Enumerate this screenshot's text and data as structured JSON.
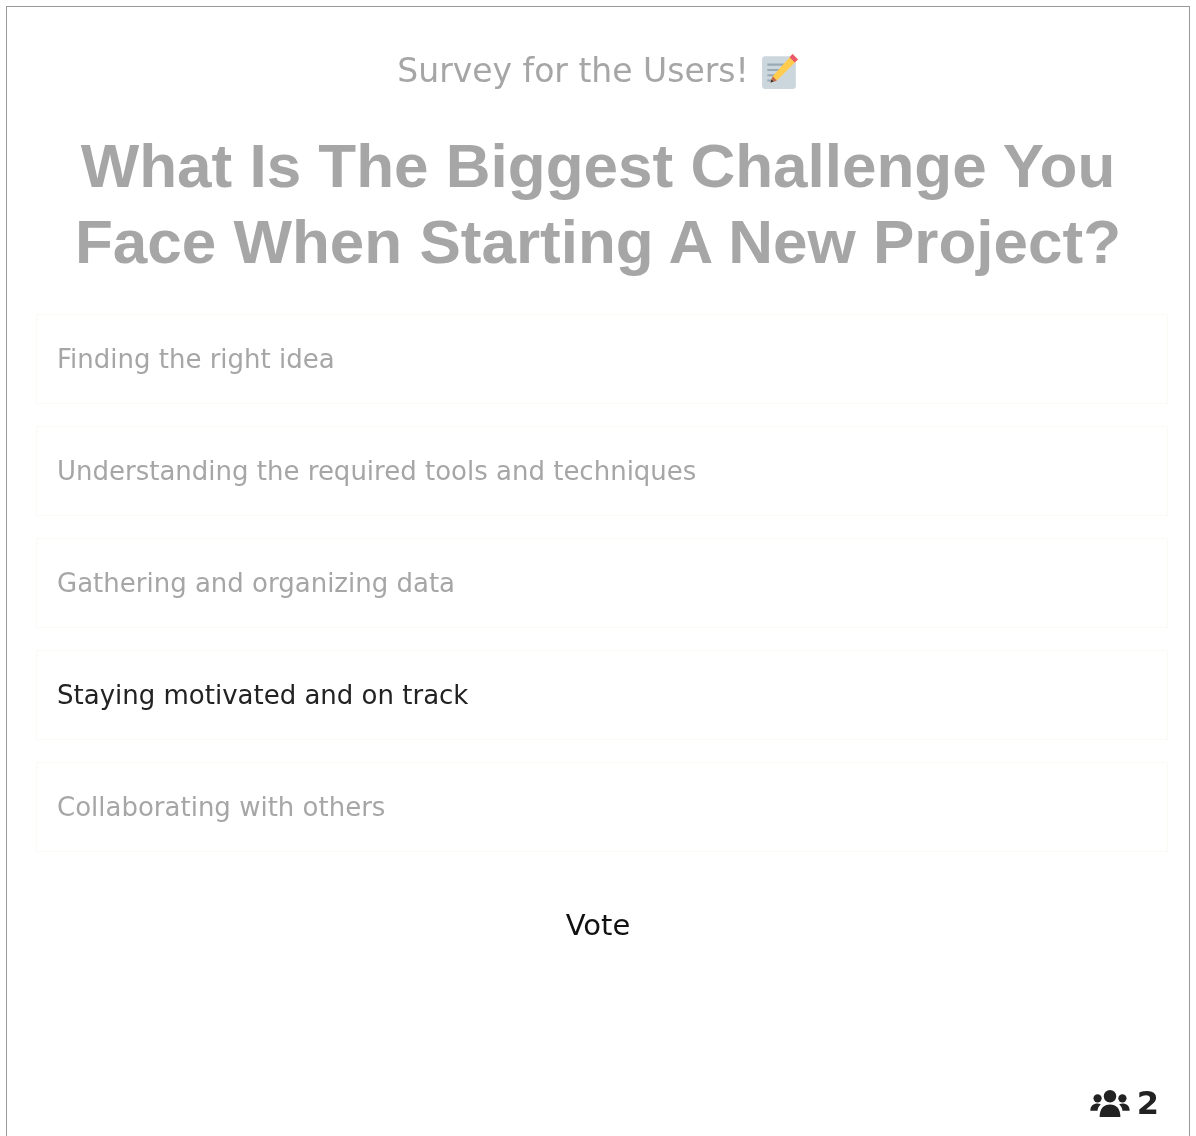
{
  "subtitle": "Survey for the Users!",
  "question": "What Is The Biggest Challenge You Face When Starting A New Project?",
  "options": [
    {
      "label": "Finding the right idea",
      "selected": false
    },
    {
      "label": "Understanding the required tools and techniques",
      "selected": false
    },
    {
      "label": "Gathering and organizing data",
      "selected": false
    },
    {
      "label": "Staying motivated and on track",
      "selected": true
    },
    {
      "label": "Collaborating with others",
      "selected": false
    }
  ],
  "vote_button": "Vote",
  "participants": "2"
}
